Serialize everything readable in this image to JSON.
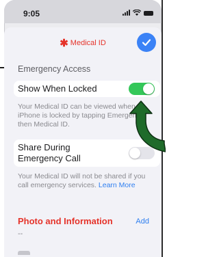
{
  "status_bar": {
    "time": "9:05",
    "icons": [
      "signal-icon",
      "wifi-icon",
      "battery-icon"
    ]
  },
  "sheet": {
    "title_icon": "asterisk-icon",
    "title": "Medical ID",
    "done_icon": "checkmark-icon"
  },
  "emergency_access": {
    "header": "Emergency Access",
    "show_when_locked": {
      "label": "Show When Locked",
      "enabled": true,
      "footnote": "Your Medical ID can be viewed when iPhone is locked by tapping Emergency, then Medical ID."
    },
    "share_during_call": {
      "label": "Share During Emergency Call",
      "enabled": false,
      "footnote": "Your Medical ID will not be shared if you call emergency services.",
      "learn_more": "Learn More"
    }
  },
  "photo_section": {
    "title": "Photo and Information",
    "add_label": "Add",
    "placeholder": "--"
  },
  "colors": {
    "accent_red": "#e5332a",
    "link_blue": "#2f7ff0",
    "toggle_on": "#34c759",
    "annotation_arrow": "#1f6b2a"
  }
}
